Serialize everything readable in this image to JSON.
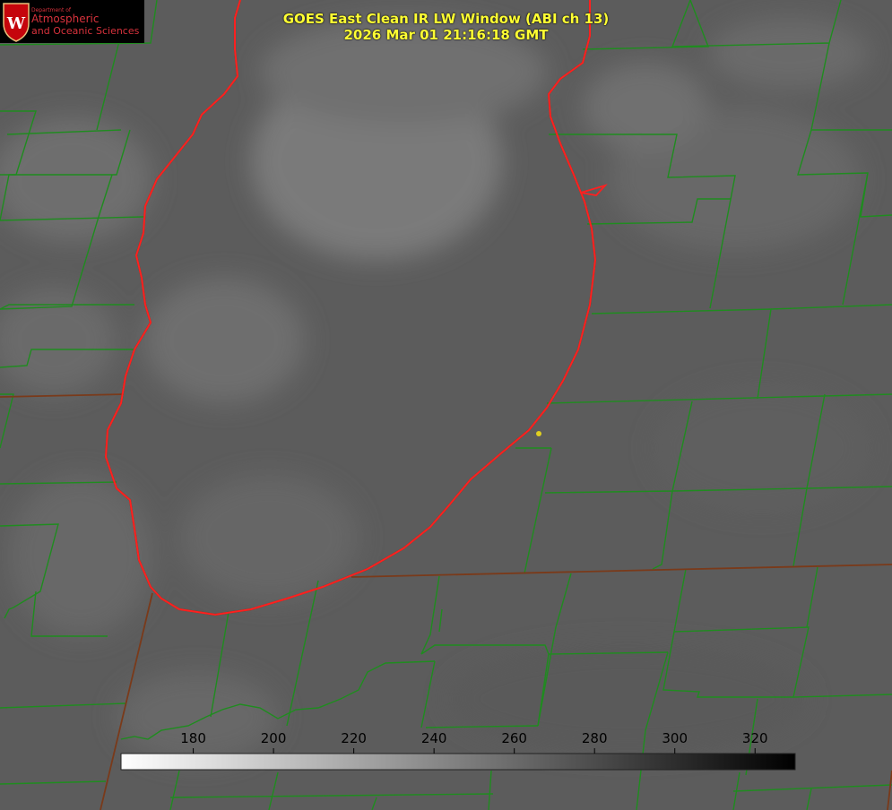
{
  "title_line1": "GOES East Clean IR LW Window (ABI ch 13)",
  "title_line2": "2026 Mar 01 21:16:18 GMT",
  "logo": {
    "department": "Department of",
    "line1": "Atmospheric",
    "line2": "and Oceanic Sciences",
    "letter": "W",
    "color": "#d8323c"
  },
  "colorbar": {
    "ticks": [
      "180",
      "200",
      "220",
      "240",
      "260",
      "280",
      "300",
      "320"
    ],
    "min": 162,
    "max": 330,
    "gradient_start": "#ffffff",
    "gradient_end": "#000000"
  },
  "map_colors": {
    "county_lines": "#1f8c1f",
    "state_lines": "#7a3a1a",
    "lake_outline": "#ff2020",
    "marker": "#e0d020"
  }
}
